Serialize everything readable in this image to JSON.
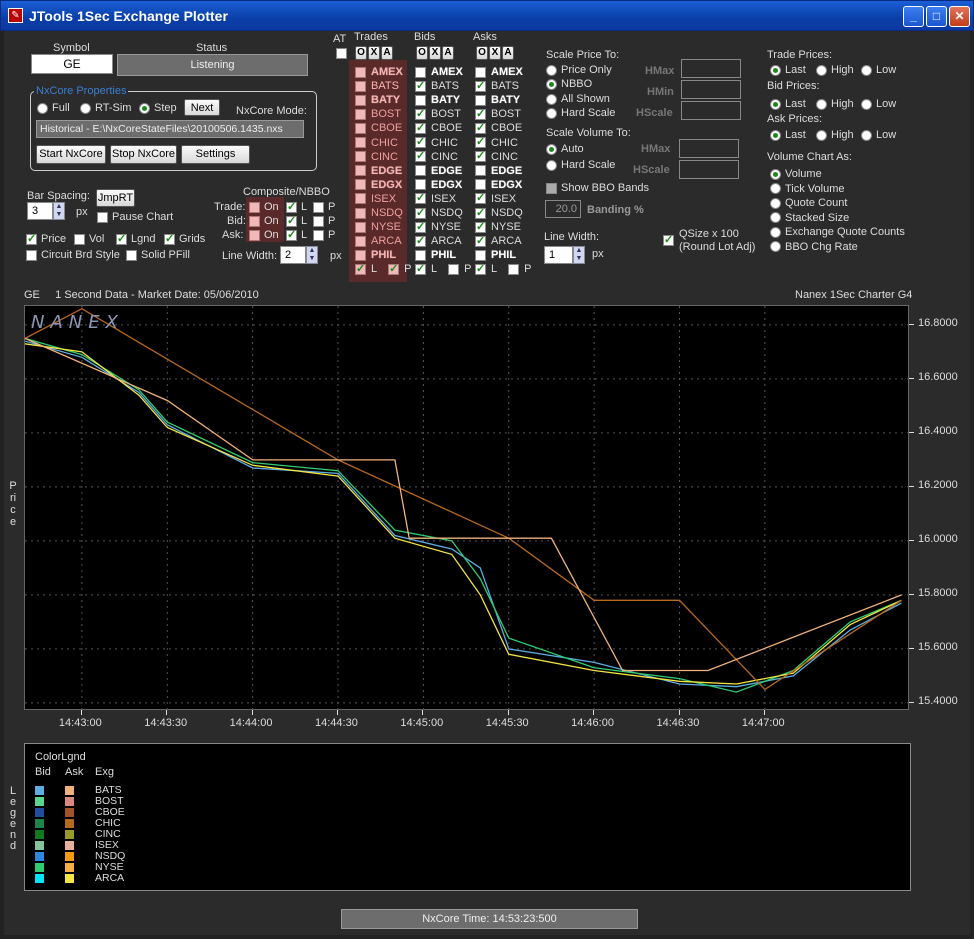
{
  "window": {
    "title": "JTools 1Sec Exchange Plotter",
    "min": "_",
    "max": "□",
    "close": "✕"
  },
  "symbol": {
    "label": "Symbol",
    "value": "GE"
  },
  "status": {
    "label": "Status",
    "value": "Listening"
  },
  "nxcore": {
    "group_label": "NxCore Properties",
    "modes": [
      "Full",
      "RT-Sim",
      "Step"
    ],
    "selected_mode": "Step",
    "next_label": "Next",
    "mode_label": "NxCore Mode:",
    "mode_value": "Historical - E:\\NxCoreStateFiles\\20100506.1435.nxs",
    "start_label": "Start NxCore",
    "stop_label": "Stop NxCore",
    "settings_label": "Settings"
  },
  "bar": {
    "label": "Bar Spacing:",
    "value": "3",
    "unit": "px",
    "jmprt": "JmpRT",
    "pause": "Pause Chart"
  },
  "options": {
    "price": "Price",
    "vol": "Vol",
    "lgnd": "Lgnd",
    "grids": "Grids",
    "circuit": "Circuit Brd Style",
    "solid": "Solid PFill"
  },
  "composite": {
    "label": "Composite/NBBO",
    "rows": [
      "Trade:",
      "Bid:",
      "Ask:"
    ],
    "on": "On",
    "l": "L",
    "p": "P",
    "linewidth_label": "Line Width:",
    "linewidth": "2",
    "unit": "px"
  },
  "at_label": "AT",
  "oxa": [
    "O",
    "X",
    "A"
  ],
  "trades": {
    "header": "Trades",
    "items": [
      "AMEX",
      "BATS",
      "BATY",
      "BOST",
      "CBOE",
      "CHIC",
      "CINC",
      "EDGE",
      "EDGX",
      "ISEX",
      "NSDQ",
      "NYSE",
      "ARCA",
      "PHIL"
    ]
  },
  "bids": {
    "header": "Bids",
    "items": [
      "AMEX",
      "BATS",
      "BATY",
      "BOST",
      "CBOE",
      "CHIC",
      "CINC",
      "EDGE",
      "EDGX",
      "ISEX",
      "NSDQ",
      "NYSE",
      "ARCA",
      "PHIL"
    ]
  },
  "asks": {
    "header": "Asks",
    "items": [
      "AMEX",
      "BATS",
      "BATY",
      "BOST",
      "CBOE",
      "CHIC",
      "CINC",
      "EDGE",
      "EDGX",
      "ISEX",
      "NSDQ",
      "NYSE",
      "ARCA",
      "PHIL"
    ]
  },
  "lp": {
    "l": "L",
    "p": "P"
  },
  "scale_price": {
    "label": "Scale Price To:",
    "options": [
      "Price Only",
      "NBBO",
      "All Shown",
      "Hard Scale"
    ],
    "selected": "NBBO",
    "hmax": "HMax",
    "hmin": "HMin",
    "hscale": "HScale"
  },
  "scale_volume": {
    "label": "Scale Volume To:",
    "options": [
      "Auto",
      "Hard Scale"
    ],
    "selected": "Auto",
    "hmax": "HMax",
    "hscale": "HScale"
  },
  "bbo": {
    "label": "Show BBO Bands",
    "value": "20.0",
    "banding": "Banding %"
  },
  "linewidth2": {
    "label": "Line Width:",
    "value": "1",
    "unit": "px"
  },
  "qsize": {
    "line1": "QSize x 100",
    "line2": "(Round Lot Adj)"
  },
  "trade_prices": {
    "label": "Trade Prices:",
    "options": [
      "Last",
      "High",
      "Low"
    ],
    "selected": "Last"
  },
  "bid_prices": {
    "label": "Bid Prices:",
    "options": [
      "Last",
      "High",
      "Low"
    ],
    "selected": "Last"
  },
  "ask_prices": {
    "label": "Ask Prices:",
    "options": [
      "Last",
      "High",
      "Low"
    ],
    "selected": "Last"
  },
  "volume_chart": {
    "label": "Volume Chart As:",
    "options": [
      "Volume",
      "Tick Volume",
      "Quote Count",
      "Stacked Size",
      "Exchange Quote Counts",
      "BBO Chg Rate"
    ],
    "selected": "Volume"
  },
  "chart_header": {
    "left": "GE     1 Second Data - Market Date: 05/06/2010",
    "right": "Nanex 1Sec Charter G4",
    "watermark": "NANEX",
    "price_axis_label": "Price"
  },
  "chart_data": {
    "type": "line",
    "ylim": [
      15.37,
      16.87
    ],
    "xlim": [
      "14:42:40",
      "14:47:51"
    ],
    "y_ticks": [
      "16.8000",
      "16.6000",
      "16.4000",
      "16.2000",
      "16.0000",
      "15.8000",
      "15.6000",
      "15.4000"
    ],
    "x_ticks": [
      "14:43:00",
      "14:43:30",
      "14:44:00",
      "14:44:30",
      "14:45:00",
      "14:45:30",
      "14:46:00",
      "14:46:30",
      "14:47:00"
    ],
    "grid": true,
    "series_note_values": [
      {
        "name": "BATS",
        "x": [
          "14:42:40",
          "14:43:00",
          "14:43:20",
          "14:43:30",
          "14:44:00",
          "14:44:30",
          "14:44:50",
          "14:45:10",
          "14:45:20",
          "14:45:30",
          "14:46:00",
          "14:46:30",
          "14:46:50",
          "14:47:10",
          "14:47:30",
          "14:47:48"
        ],
        "y": [
          16.74,
          16.68,
          16.55,
          16.43,
          16.27,
          16.25,
          16.02,
          15.97,
          15.9,
          15.6,
          15.55,
          15.47,
          15.46,
          15.5,
          15.67,
          15.77
        ]
      },
      {
        "name": "NYSE",
        "x": [
          "14:42:40",
          "14:43:00",
          "14:43:20",
          "14:43:30",
          "14:44:00",
          "14:44:30",
          "14:44:50",
          "14:45:10",
          "14:45:20",
          "14:45:30",
          "14:46:00",
          "14:46:30",
          "14:46:50",
          "14:47:10",
          "14:47:30",
          "14:47:48"
        ],
        "y": [
          16.75,
          16.69,
          16.56,
          16.44,
          16.29,
          16.26,
          16.04,
          16.0,
          15.86,
          15.64,
          15.53,
          15.49,
          15.44,
          15.52,
          15.7,
          15.78
        ]
      },
      {
        "name": "ARCA",
        "x": [
          "14:42:40",
          "14:43:00",
          "14:43:20",
          "14:43:30",
          "14:44:00",
          "14:44:30",
          "14:44:50",
          "14:45:10",
          "14:45:20",
          "14:45:30",
          "14:46:00",
          "14:46:30",
          "14:46:50",
          "14:47:10",
          "14:47:30",
          "14:47:48"
        ],
        "y": [
          16.73,
          16.7,
          16.54,
          16.42,
          16.28,
          16.24,
          16.01,
          15.95,
          15.8,
          15.58,
          15.52,
          15.48,
          15.47,
          15.51,
          15.69,
          15.78
        ]
      },
      {
        "name": "AMEX",
        "x": [
          "14:42:40",
          "14:43:00",
          "14:44:30",
          "14:45:30",
          "14:46:00",
          "14:46:30",
          "14:47:00",
          "14:47:48"
        ],
        "y": [
          16.75,
          16.86,
          16.3,
          16.01,
          15.78,
          15.78,
          15.45,
          15.78
        ]
      },
      {
        "name": "CHIC",
        "x": [
          "14:42:40",
          "14:43:30",
          "14:44:00",
          "14:44:50",
          "14:44:55",
          "14:45:45",
          "14:46:10",
          "14:46:40",
          "14:47:48"
        ],
        "y": [
          16.75,
          16.52,
          16.3,
          16.3,
          16.01,
          16.01,
          15.52,
          15.52,
          15.8
        ]
      }
    ]
  },
  "legend": {
    "title": "ColorLgnd",
    "headers": [
      "Bid",
      "Ask",
      "Exg"
    ],
    "rows": [
      {
        "exg": "BATS",
        "bid": "#5dade2",
        "ask": "#f0b27a"
      },
      {
        "exg": "BOST",
        "bid": "#58d68d",
        "ask": "#d98880"
      },
      {
        "exg": "CBOE",
        "bid": "#1f4e9c",
        "ask": "#a0522d"
      },
      {
        "exg": "CHIC",
        "bid": "#1e8449",
        "ask": "#b7691e"
      },
      {
        "exg": "CINC",
        "bid": "#117a1e",
        "ask": "#9a9a2a"
      },
      {
        "exg": "ISEX",
        "bid": "#82c39a",
        "ask": "#e8b09a"
      },
      {
        "exg": "NSDQ",
        "bid": "#2e86de",
        "ask": "#f39c12"
      },
      {
        "exg": "NYSE",
        "bid": "#2ecc71",
        "ask": "#f5b041"
      },
      {
        "exg": "ARCA",
        "bid": "#00e5ff",
        "ask": "#f4e542"
      }
    ],
    "side_label": "Legend"
  },
  "footer": {
    "nxcore_time": "NxCore Time: 14:53:23:500"
  }
}
